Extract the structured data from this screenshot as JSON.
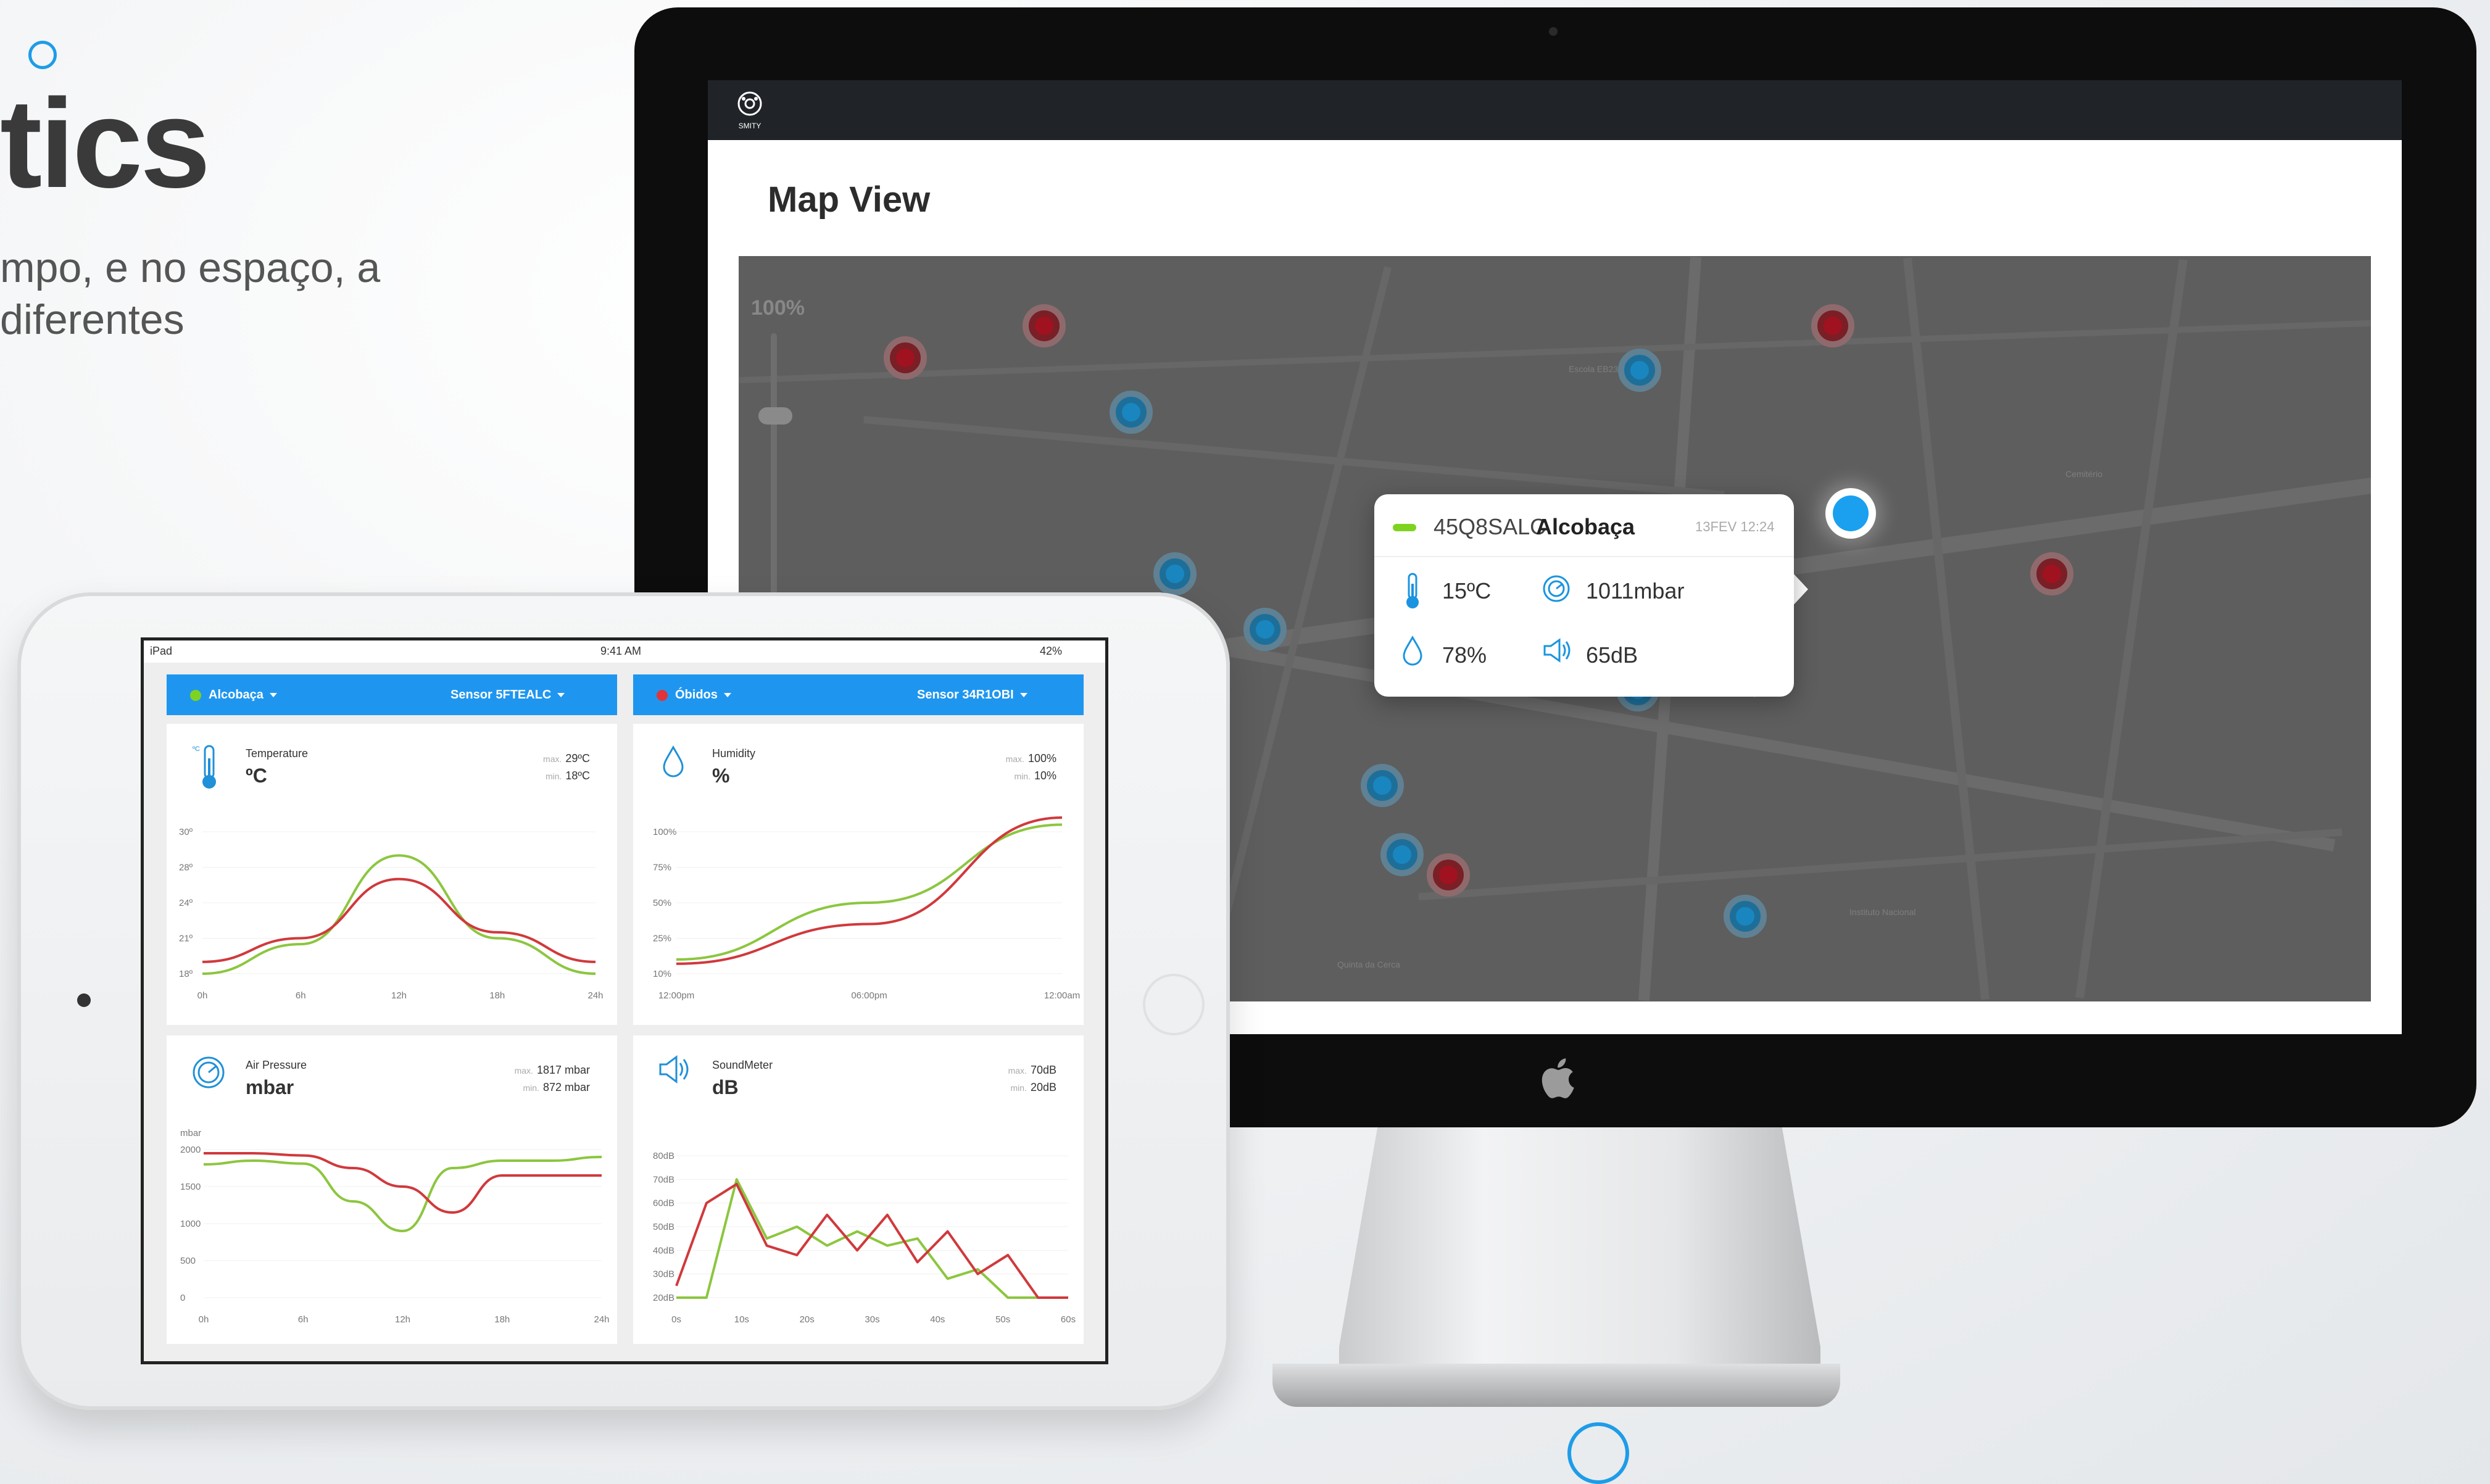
{
  "hero": {
    "title": "tics",
    "line1": "mpo, e no espaço, a",
    "line2": "diferentes"
  },
  "imac": {
    "topbar": {
      "logo_text": "SMITY"
    },
    "page_title": "Map View",
    "map": {
      "zoom_label": "100%",
      "pins_red": 5,
      "pins_blue": 11
    },
    "tooltip": {
      "status_color": "#7ed321",
      "sensor_id": "45Q8SALC",
      "city": "Alcobaça",
      "time": "13FEV 12:24",
      "temperature": "15ºC",
      "pressure": "1011mbar",
      "humidity": "78%",
      "sound": "65dB"
    }
  },
  "ipad": {
    "status": {
      "left": "iPad",
      "time": "9:41 AM",
      "battery": "42%"
    },
    "panels": [
      {
        "location": "Alcobaça",
        "sensor": "Sensor 5FTEALC",
        "dot_color": "#7ed321"
      },
      {
        "location": "Óbidos",
        "sensor": "Sensor 34R1OBI",
        "dot_color": "#e0343a"
      }
    ],
    "cards": {
      "temperature": {
        "label": "Temperature",
        "unit": "ºC",
        "max_label": "max.",
        "max": "29ºC",
        "min_label": "min.",
        "min": "18ºC"
      },
      "humidity": {
        "label": "Humidity",
        "unit": "%",
        "max_label": "max.",
        "max": "100%",
        "min_label": "min.",
        "min": "10%"
      },
      "pressure": {
        "label": "Air Pressure",
        "unit": "mbar",
        "max_label": "max.",
        "max": "1817 mbar",
        "min_label": "min.",
        "min": "872 mbar",
        "y_unit": "mbar"
      },
      "sound": {
        "label": "SoundMeter",
        "unit": "dB",
        "max_label": "max.",
        "max": "70dB",
        "min_label": "min.",
        "min": "20dB"
      }
    },
    "colors": {
      "green": "#8cc63f",
      "red": "#d0393c",
      "accent": "#1e96f0"
    }
  },
  "chart_data": [
    {
      "type": "line",
      "title": "Temperature",
      "x": [
        "0h",
        "6h",
        "12h",
        "18h",
        "24h"
      ],
      "y_ticks": [
        "30º",
        "28º",
        "24º",
        "21º",
        "18º"
      ],
      "ylim": [
        18,
        30
      ],
      "series": [
        {
          "values": [
            18,
            20.5,
            28,
            21,
            18
          ]
        },
        {
          "values": [
            19,
            21,
            26,
            21.5,
            19
          ]
        }
      ]
    },
    {
      "type": "line",
      "title": "Humidity",
      "x": [
        "12:00pm",
        "06:00pm",
        "12:00am"
      ],
      "y_ticks": [
        "100%",
        "75%",
        "50%",
        "25%",
        "10%"
      ],
      "ylim": [
        0,
        100
      ],
      "series": [
        {
          "values": [
            10,
            50,
            105
          ]
        },
        {
          "values": [
            7,
            35,
            110
          ]
        }
      ]
    },
    {
      "type": "line",
      "title": "Air Pressure",
      "x": [
        "0h",
        "6h",
        "12h",
        "18h",
        "24h"
      ],
      "y_ticks": [
        "2000",
        "1500",
        "1000",
        "500",
        "0"
      ],
      "ylim": [
        0,
        2000
      ],
      "series": [
        {
          "values": [
            1800,
            1850,
            1810,
            1300,
            900,
            1750,
            1850,
            1850,
            1900
          ]
        },
        {
          "values": [
            1950,
            1950,
            1920,
            1750,
            1500,
            1150,
            1650,
            1650,
            1650
          ]
        }
      ]
    },
    {
      "type": "line",
      "title": "SoundMeter",
      "x": [
        "0s",
        "10s",
        "20s",
        "30s",
        "40s",
        "50s",
        "60s"
      ],
      "y_ticks": [
        "80dB",
        "70dB",
        "60dB",
        "50dB",
        "40dB",
        "30dB",
        "20dB"
      ],
      "ylim": [
        20,
        80
      ],
      "series": [
        {
          "values": [
            20,
            20,
            70,
            45,
            50,
            42,
            48,
            42,
            45,
            28,
            32,
            20,
            20,
            20
          ]
        },
        {
          "values": [
            25,
            60,
            68,
            42,
            38,
            55,
            40,
            55,
            35,
            48,
            30,
            38,
            20,
            20
          ]
        }
      ]
    }
  ]
}
